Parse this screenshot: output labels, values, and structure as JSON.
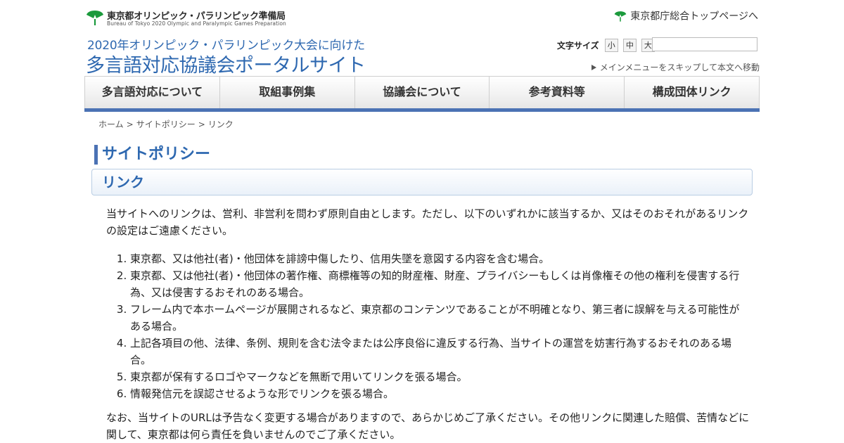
{
  "header": {
    "logo_jp": "東京都オリンピック・パラリンピック準備局",
    "logo_en": "Bureau of Tokyo 2020 Olympic and Paralympic Games Preparation",
    "top_link": "東京都庁総合トップページへ",
    "subtitle": "2020年オリンピック・パラリンピック大会に向けた",
    "site_title": "多言語対応協議会ポータルサイト",
    "font_size_label": "文字サイズ",
    "font_sizes": [
      "小",
      "中",
      "大"
    ],
    "search_value": "",
    "skip_link": "メインメニューをスキップして本文へ移動"
  },
  "nav": {
    "items": [
      "多言語対応について",
      "取組事例集",
      "協議会について",
      "参考資料等",
      "構成団体リンク"
    ]
  },
  "breadcrumb": [
    "ホーム",
    "サイトポリシー",
    "リンク"
  ],
  "breadcrumb_sep": ">",
  "page_title": "サイトポリシー",
  "section": {
    "heading": "リンク",
    "intro": "当サイトへのリンクは、営利、非営利を問わず原則自由とします。ただし、以下のいずれかに該当するか、又はそのおそれがあるリンクの設定はご遠慮ください。",
    "items": [
      "東京都、又は他社(者)・他団体を誹謗中傷したり、信用失墜を意図する内容を含む場合。",
      "東京都、又は他社(者)・他団体の著作権、商標権等の知的財産権、財産、プライバシーもしくは肖像権その他の権利を侵害する行為、又は侵害するおそれのある場合。",
      "フレーム内で本ホームページが展開されるなど、東京都のコンテンツであることが不明確となり、第三者に誤解を与える可能性がある場合。",
      "上記各項目の他、法律、条例、規則を含む法令または公序良俗に違反する行為、当サイトの運営を妨害行為するおそれのある場合。",
      "東京都が保有するロゴやマークなどを無断で用いてリンクを張る場合。",
      "情報発信元を誤認させるような形でリンクを張る場合。"
    ],
    "outro": "なお、当サイトのURLは予告なく変更する場合がありますので、あらかじめご了承ください。その他リンクに関連した賠償、苦情などに関して、東京都は何ら責任を負いませんのでご了承ください。"
  },
  "colors": {
    "accent_blue": "#2e68b0",
    "nav_bar": "#4b72b4",
    "ginkgo_green": "#1b9a3c"
  }
}
